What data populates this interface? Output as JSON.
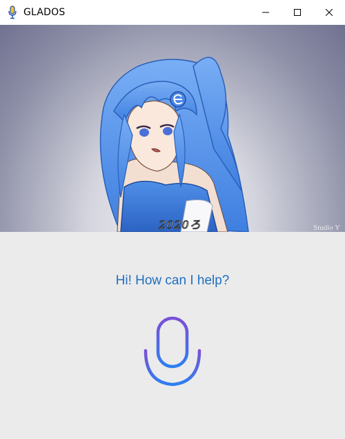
{
  "window": {
    "title": "GLADOS",
    "controls": [
      "minimize",
      "maximize",
      "close"
    ]
  },
  "media": {
    "caption": "2020ろ",
    "watermark": "Studio Y"
  },
  "assistant": {
    "greeting": "Hi! How can I help?",
    "mic_icon": "microphone-icon",
    "mic_gradient": [
      "#7b4fd6",
      "#2d7ff0"
    ]
  },
  "colors": {
    "greeting_text": "#1f6fc0",
    "background": "#ebebeb",
    "titlebar": "#ffffff"
  }
}
